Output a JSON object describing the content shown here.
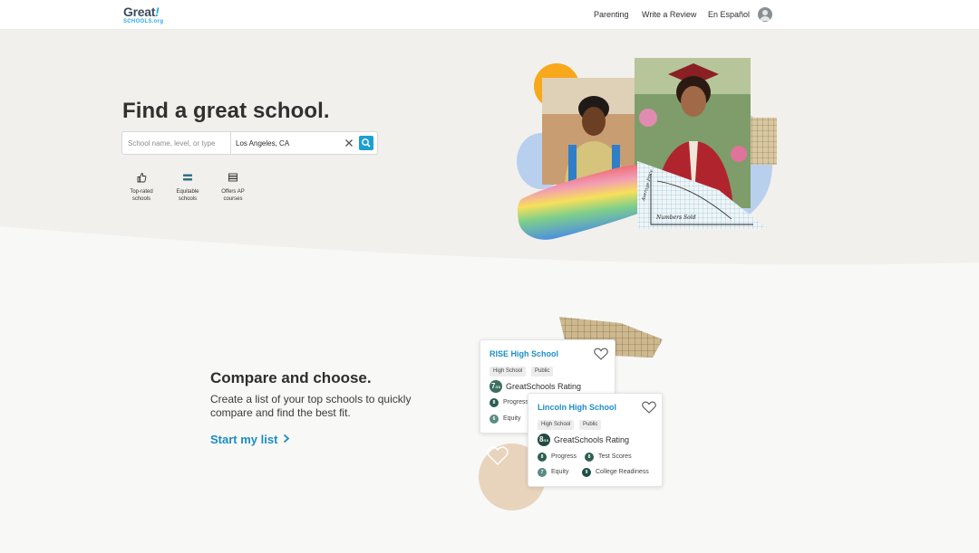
{
  "header": {
    "logo_top": "Great",
    "logo_bang": "!",
    "logo_bottom": "SCHOOLS.org",
    "nav": [
      "Parenting",
      "Write a Review",
      "En Español"
    ],
    "avatar_icon": "user-avatar-icon"
  },
  "hero": {
    "title": "Find a great school.",
    "search": {
      "placeholder": "School name, level, or type",
      "location": "Los Angeles, CA",
      "clear_icon": "close-icon",
      "submit_icon": "search-icon"
    },
    "filters": [
      {
        "label_line1": "Top-rated",
        "label_line2": "schools",
        "icon": "thumbs-up-icon"
      },
      {
        "label_line1": "Equitable",
        "label_line2": "schools",
        "icon": "balance-bars-icon"
      },
      {
        "label_line1": "Offers AP",
        "label_line2": "courses",
        "icon": "book-stack-icon"
      }
    ],
    "illustration_texts": {
      "x_axis": "Numbers Sold",
      "y_axis": "Average Price"
    }
  },
  "compare": {
    "title": "Compare and choose.",
    "subtitle": "Create a list of your top schools to quickly compare and find the best fit.",
    "link": "Start my list",
    "cards": [
      {
        "name": "RISE High School",
        "tags": [
          "High School",
          "Public"
        ],
        "rating": "7",
        "rating_suffix": "/10",
        "rating_label": "GreatSchools Rating",
        "subratings": [
          {
            "score": "8",
            "label": "Progress"
          },
          {
            "score": "6",
            "label": "Equity"
          }
        ]
      },
      {
        "name": "Lincoln High School",
        "tags": [
          "High School",
          "Public"
        ],
        "rating": "8",
        "rating_suffix": "/10",
        "rating_label": "GreatSchools Rating",
        "subratings": [
          {
            "score": "8",
            "label": "Progress"
          },
          {
            "score": "8",
            "label": "Test Scores"
          },
          {
            "score": "7",
            "label": "Equity"
          },
          {
            "score": "9",
            "label": "College Readiness"
          }
        ]
      }
    ]
  },
  "colors": {
    "brand_blue": "#1d9fd3",
    "link_blue": "#1a8dc3",
    "rating_green": "#3b6e60",
    "hero_bg": "#f2f0ec"
  }
}
